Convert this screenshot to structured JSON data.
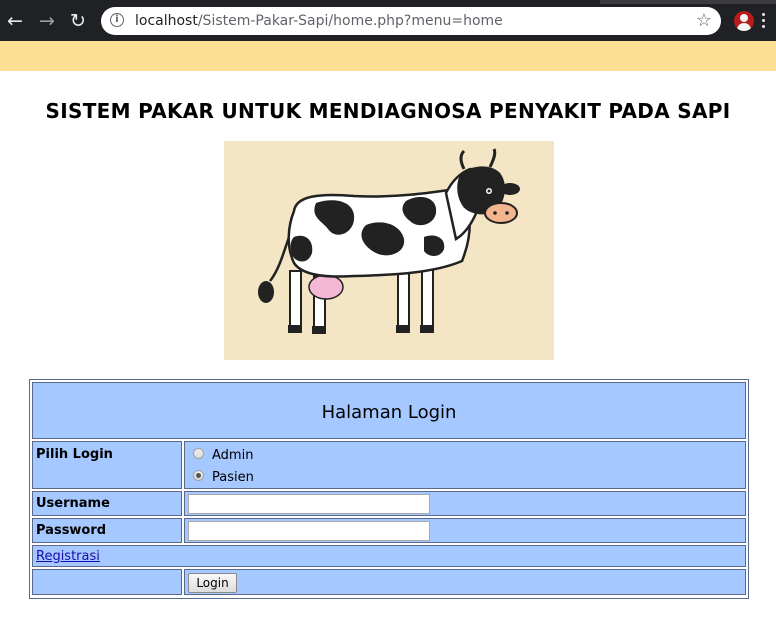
{
  "browser": {
    "url_host": "localhost",
    "url_path": "/Sistem-Pakar-Sapi/home.php?menu=home",
    "back_icon": "←",
    "forward_icon": "→",
    "reload_icon": "↻",
    "star_icon": "☆"
  },
  "page": {
    "title": "SISTEM PAKAR UNTUK MENDIAGNOSA PENYAKIT PADA SAPI",
    "banner_color": "#fcdf93"
  },
  "login": {
    "heading": "Halaman Login",
    "pilih_label": "Pilih Login",
    "options": [
      {
        "label": "Admin",
        "selected": false
      },
      {
        "label": "Pasien",
        "selected": true
      }
    ],
    "username_label": "Username",
    "username_value": "",
    "password_label": "Password",
    "password_value": "",
    "register_link": "Registrasi",
    "submit_label": "Login",
    "table_bg": "#a4c8ff"
  }
}
